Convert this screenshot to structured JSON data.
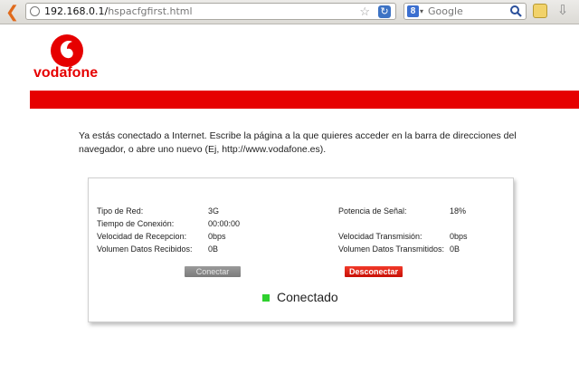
{
  "browser": {
    "url_host": "192.168.0.1/",
    "url_path": "hspacfgfirst.html",
    "search_engine_letter": "8",
    "search_placeholder": "Google"
  },
  "brand": {
    "name": "vodafone",
    "color": "#e60000"
  },
  "intro_text": "Ya estás conectado a Internet. Escribe la página a la que quieres acceder en la barra de direcciones del navegador, o abre uno nuevo (Ej, http://www.vodafone.es).",
  "status_panel": {
    "left_fields": [
      {
        "label": "Tipo de Red:",
        "value": "3G"
      },
      {
        "label": "Tiempo de Conexión:",
        "value": "00:00:00"
      },
      {
        "label": "Velocidad de Recepcion:",
        "value": "0bps"
      },
      {
        "label": "Volumen Datos Recibidos:",
        "value": "0B"
      }
    ],
    "right_fields": [
      {
        "label": "Potencia de Señal:",
        "value": "18%"
      },
      {
        "label": "Velocidad Transmisión:",
        "value": "0bps"
      },
      {
        "label": "Volumen Datos Transmitidos:",
        "value": "0B"
      }
    ],
    "connect_label": "Conectar",
    "disconnect_label": "Desconectar",
    "status_text": "Conectado",
    "status_color": "#2fd12f"
  }
}
